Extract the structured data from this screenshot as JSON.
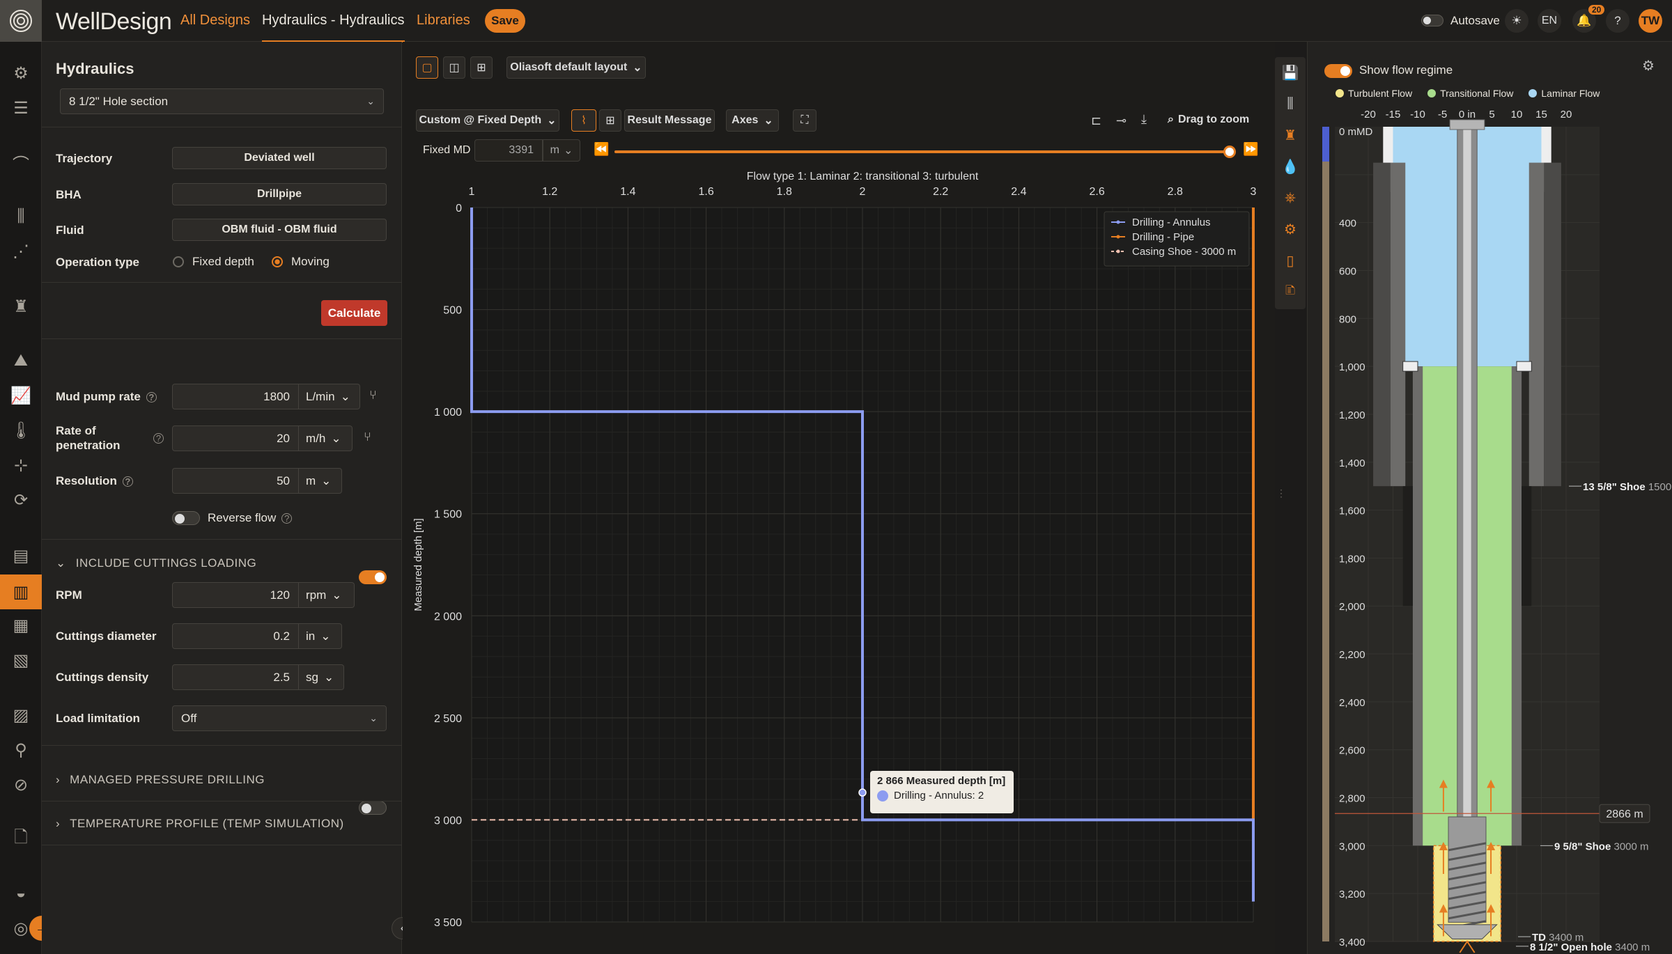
{
  "app": {
    "brand": "WellDesign",
    "nav_all_designs": "All Designs",
    "nav_current": "Hydraulics - Hydraulics",
    "nav_libraries": "Libraries",
    "save_label": "Save"
  },
  "topbar_right": {
    "autosave_label": "Autosave",
    "language": "EN",
    "notifications_count": "20",
    "help": "?",
    "user_initials": "TW"
  },
  "left_panel": {
    "title": "Hydraulics",
    "section_select": "8 1/2\" Hole section",
    "trajectory_label": "Trajectory",
    "trajectory_value": "Deviated well",
    "bha_label": "BHA",
    "bha_value": "Drillpipe",
    "fluid_label": "Fluid",
    "fluid_value": "OBM fluid - OBM fluid",
    "operation_label": "Operation type",
    "op_fixed": "Fixed depth",
    "op_moving": "Moving",
    "calculate": "Calculate",
    "mud_pump_label": "Mud pump rate",
    "mud_pump_value": "1800",
    "mud_pump_unit": "L/min",
    "rop_label_1": "Rate of",
    "rop_label_2": "penetration",
    "rop_value": "20",
    "rop_unit": "m/h",
    "resolution_label": "Resolution",
    "resolution_value": "50",
    "resolution_unit": "m",
    "reverse_flow": "Reverse flow",
    "cuttings_header": "INCLUDE CUTTINGS LOADING",
    "rpm_label": "RPM",
    "rpm_value": "120",
    "rpm_unit": "rpm",
    "cut_diam_label": "Cuttings diameter",
    "cut_diam_value": "0.2",
    "cut_diam_unit": "in",
    "cut_dens_label": "Cuttings density",
    "cut_dens_value": "2.5",
    "cut_dens_unit": "sg",
    "load_lim_label": "Load limitation",
    "load_lim_value": "Off",
    "mpd_header": "MANAGED PRESSURE DRILLING",
    "temp_header": "TEMPERATURE PROFILE (TEMP SIMULATION)"
  },
  "center": {
    "layout_select": "Oliasoft default layout",
    "mode_select": "Custom @ Fixed Depth",
    "result_message": "Result Message",
    "axes": "Axes",
    "drag_zoom": "Drag to zoom",
    "fixed_md_label": "Fixed MD",
    "fixed_md_value": "3391",
    "fixed_md_unit": "m",
    "slider_fraction": 0.99,
    "tooltip_title": "2 866 Measured depth [m]",
    "tooltip_series": "Drilling - Annulus: 2"
  },
  "chart_data": {
    "type": "line",
    "title": "Flow type 1: Laminar 2: transitional 3: turbulent",
    "xlabel": "",
    "ylabel": "Measured depth [m]",
    "xlim": [
      1,
      3
    ],
    "ylim": [
      0,
      3500
    ],
    "y_inverted": true,
    "x_position": "top",
    "x_ticks": [
      "1",
      "1.2",
      "1.4",
      "1.6",
      "1.8",
      "2",
      "2.2",
      "2.4",
      "2.6",
      "2.8",
      "3"
    ],
    "y_ticks": [
      "0",
      "500",
      "1 000",
      "1 500",
      "2 000",
      "2 500",
      "3 000",
      "3 500"
    ],
    "legend_position": "top-right",
    "series": [
      {
        "name": "Drilling - Annulus",
        "color": "#8c9cf0",
        "points": [
          [
            1,
            0
          ],
          [
            1,
            1000
          ],
          [
            2,
            1000
          ],
          [
            2,
            3000
          ],
          [
            3,
            3000
          ],
          [
            3,
            3400
          ]
        ]
      },
      {
        "name": "Drilling - Pipe",
        "color": "#e67e22",
        "points": [
          [
            3,
            0
          ],
          [
            3,
            3000
          ]
        ]
      },
      {
        "name": "Casing Shoe - 3000 m",
        "color": "#f2c1b0",
        "dashed": true,
        "points": [
          [
            1,
            3000
          ],
          [
            3,
            3000
          ]
        ]
      }
    ]
  },
  "right_panel": {
    "show_flow_regime": "Show flow regime",
    "legend_turbulent": "Turbulent Flow",
    "legend_transitional": "Transitional Flow",
    "legend_laminar": "Laminar Flow",
    "color_turbulent": "#f2e58a",
    "color_transitional": "#a8dc8c",
    "color_laminar": "#a9d7f3",
    "x_ticks": [
      "-20",
      "-15",
      "-10",
      "-5",
      "0 in",
      "5",
      "10",
      "15",
      "20"
    ],
    "depth_label_0": "0 mMD",
    "depth_ticks": [
      "400",
      "600",
      "800",
      "1,000",
      "1,200",
      "1,400",
      "1,600",
      "1,800",
      "2,000",
      "2,200",
      "2,400",
      "2,600",
      "2,800",
      "3,000",
      "3,200",
      "3,400"
    ],
    "shoe_13_label": "13 5/8\" Shoe",
    "shoe_13_depth": "1500",
    "shoe_9_label": "9 5/8\" Shoe",
    "shoe_9_depth": "3000 m",
    "current_depth": "2866 m",
    "td_label": "TD",
    "td_depth": "3400 m",
    "open_hole_label": "8 1/2\" Open hole",
    "open_hole_depth": "3400 m"
  }
}
